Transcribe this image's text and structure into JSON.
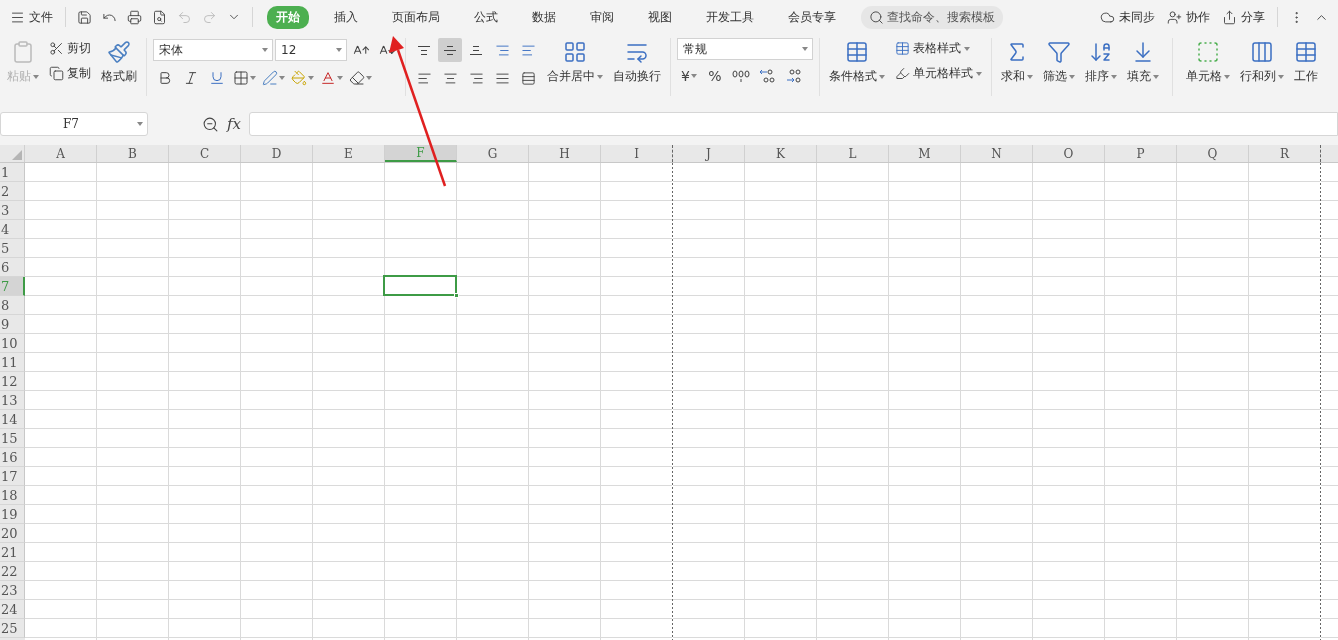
{
  "menu": {
    "label": "文件"
  },
  "tabs": [
    {
      "label": "开始",
      "selected": true
    },
    {
      "label": "插入",
      "selected": false
    },
    {
      "label": "页面布局",
      "selected": false
    },
    {
      "label": "公式",
      "selected": false
    },
    {
      "label": "数据",
      "selected": false
    },
    {
      "label": "审阅",
      "selected": false
    },
    {
      "label": "视图",
      "selected": false
    },
    {
      "label": "开发工具",
      "selected": false
    },
    {
      "label": "会员专享",
      "selected": false
    }
  ],
  "search": {
    "placeholder": "查找命令、搜索模板"
  },
  "account_actions": [
    {
      "kind": "sync",
      "label": "未同步"
    },
    {
      "kind": "collab",
      "label": "协作"
    },
    {
      "kind": "share",
      "label": "分享"
    }
  ],
  "ribbon": {
    "clipboard": {
      "paste": {
        "label": "粘贴",
        "disabled": true
      },
      "cut": "剪切",
      "copy": "复制",
      "format_painter": "格式刷"
    },
    "font": {
      "name": "宋体",
      "size": "12"
    },
    "vertical_align": [
      {
        "kind": "top",
        "selected": false
      },
      {
        "kind": "middle",
        "selected": true
      },
      {
        "kind": "bottom",
        "selected": false
      }
    ],
    "merge": "合并居中",
    "wrap": "自动换行",
    "number": {
      "format": "常规",
      "currency": "¥",
      "percent": "%"
    },
    "styles": {
      "conditional": "条件格式",
      "table_style": "表格样式",
      "cell_style": "单元格样式"
    },
    "tools": [
      {
        "kind": "sum",
        "label": "求和"
      },
      {
        "kind": "filter",
        "label": "筛选"
      },
      {
        "kind": "sort",
        "label": "排序"
      },
      {
        "kind": "fill",
        "label": "填充"
      },
      {
        "kind": "cell",
        "label": "单元格"
      },
      {
        "kind": "rowcol",
        "label": "行和列"
      },
      {
        "kind": "sheet",
        "label": "工作"
      }
    ]
  },
  "formula_bar": {
    "name_box": "F7",
    "fx": "fx"
  },
  "sheet": {
    "columns": [
      {
        "label": "A",
        "selected": false,
        "page_break": false
      },
      {
        "label": "B",
        "selected": false,
        "page_break": false
      },
      {
        "label": "C",
        "selected": false,
        "page_break": false
      },
      {
        "label": "D",
        "selected": false,
        "page_break": false
      },
      {
        "label": "E",
        "selected": false,
        "page_break": false
      },
      {
        "label": "F",
        "selected": true,
        "page_break": false
      },
      {
        "label": "G",
        "selected": false,
        "page_break": false
      },
      {
        "label": "H",
        "selected": false,
        "page_break": false
      },
      {
        "label": "I",
        "selected": false,
        "page_break": true
      },
      {
        "label": "J",
        "selected": false,
        "page_break": false
      },
      {
        "label": "K",
        "selected": false,
        "page_break": false
      },
      {
        "label": "L",
        "selected": false,
        "page_break": false
      },
      {
        "label": "M",
        "selected": false,
        "page_break": false
      },
      {
        "label": "N",
        "selected": false,
        "page_break": false
      },
      {
        "label": "O",
        "selected": false,
        "page_break": false
      },
      {
        "label": "P",
        "selected": false,
        "page_break": false
      },
      {
        "label": "Q",
        "selected": false,
        "page_break": false
      },
      {
        "label": "R",
        "selected": false,
        "page_break": true
      }
    ],
    "rows": [
      {
        "label": "1",
        "selected": false
      },
      {
        "label": "2",
        "selected": false
      },
      {
        "label": "3",
        "selected": false
      },
      {
        "label": "4",
        "selected": false
      },
      {
        "label": "5",
        "selected": false
      },
      {
        "label": "6",
        "selected": false
      },
      {
        "label": "7",
        "selected": true
      },
      {
        "label": "8",
        "selected": false
      },
      {
        "label": "9",
        "selected": false
      },
      {
        "label": "10",
        "selected": false
      },
      {
        "label": "11",
        "selected": false
      },
      {
        "label": "12",
        "selected": false
      },
      {
        "label": "13",
        "selected": false
      },
      {
        "label": "14",
        "selected": false
      },
      {
        "label": "15",
        "selected": false
      },
      {
        "label": "16",
        "selected": false
      },
      {
        "label": "17",
        "selected": false
      },
      {
        "label": "18",
        "selected": false
      },
      {
        "label": "19",
        "selected": false
      },
      {
        "label": "20",
        "selected": false
      },
      {
        "label": "21",
        "selected": false
      },
      {
        "label": "22",
        "selected": false
      },
      {
        "label": "23",
        "selected": false
      },
      {
        "label": "24",
        "selected": false
      },
      {
        "label": "25",
        "selected": false
      }
    ]
  }
}
